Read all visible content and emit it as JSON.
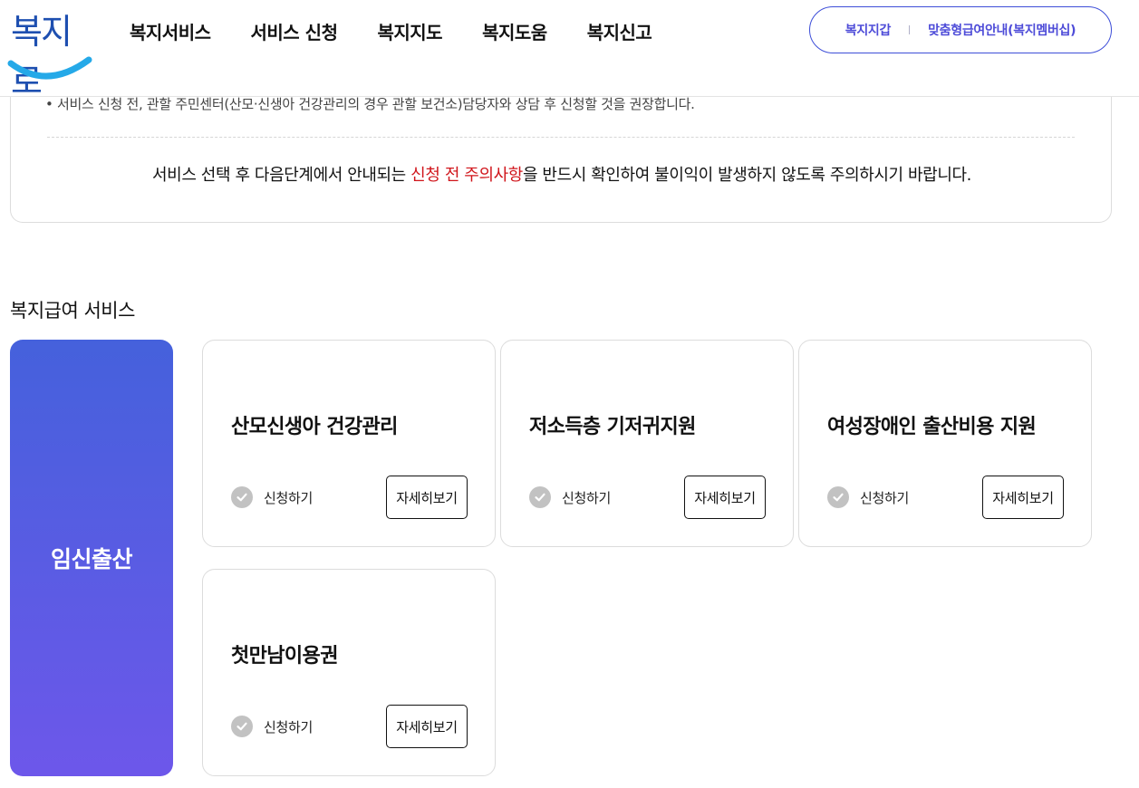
{
  "header": {
    "logo_text": "복지로",
    "nav": [
      "복지서비스",
      "서비스 신청",
      "복지지도",
      "복지도움",
      "복지신고"
    ],
    "util_links": [
      "복지지갑",
      "맞춤형급여안내(복지멤버십)"
    ]
  },
  "notice": {
    "bullet": "• 서비스 신청 전, 관할 주민센터(산모·신생아 건강관리의 경우 관할 보건소)담당자와 상담 후 신청할 것을 권장합니다.",
    "main_before": "서비스 선택 후 다음단계에서 안내되는 ",
    "main_highlight": "신청 전 주의사항",
    "main_after": "을 반드시 확인하여 불이익이 발생하지 않도록 주의하시기 바랍니다.",
    "highlight_color": "#d0141a"
  },
  "section": {
    "title": "복지급여 서비스",
    "category": "임신출산",
    "cards": [
      {
        "title": "산모신생아 건강관리",
        "apply_label": "신청하기",
        "detail_label": "자세히보기"
      },
      {
        "title": "저소득층 기저귀지원",
        "apply_label": "신청하기",
        "detail_label": "자세히보기"
      },
      {
        "title": "여성장애인 출산비용 지원",
        "apply_label": "신청하기",
        "detail_label": "자세히보기"
      },
      {
        "title": "첫만남이용권",
        "apply_label": "신청하기",
        "detail_label": "자세히보기"
      }
    ]
  },
  "colors": {
    "accent": "#4e4cd8",
    "category_gradient_top": "#4561dc",
    "category_gradient_bottom": "#6d57ea",
    "check_gray": "#c2c2c2"
  },
  "icons": {
    "check": "check-circle-icon"
  }
}
